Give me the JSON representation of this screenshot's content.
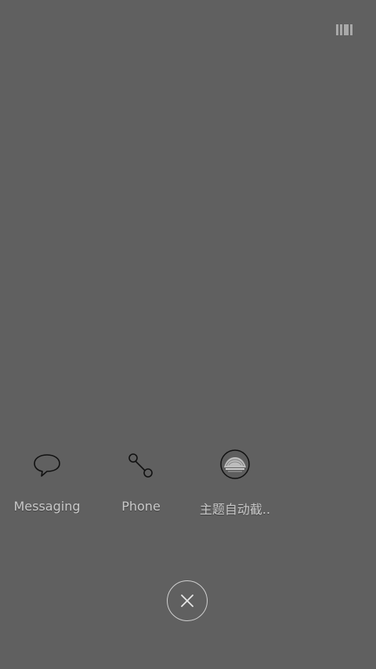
{
  "background_color": "#606060",
  "top_right": {
    "icon": "menu-bars-icon"
  },
  "apps": [
    {
      "label": "Messaging",
      "icon": "speech-bubble-icon"
    },
    {
      "label": "Phone",
      "icon": "phone-handset-icon"
    },
    {
      "label": "主题自动截..",
      "icon": "theme-screenshot-icon"
    }
  ],
  "close": {
    "icon": "close-icon"
  }
}
